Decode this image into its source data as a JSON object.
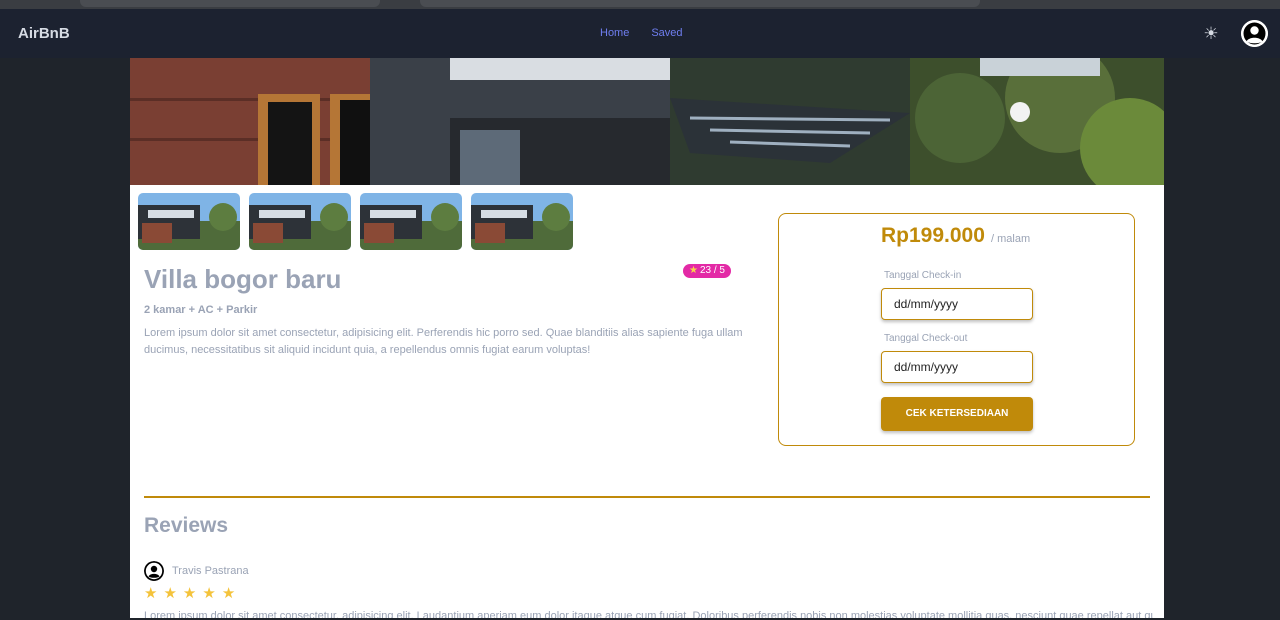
{
  "navbar": {
    "brand": "AirBnB",
    "links": [
      "Home",
      "Saved"
    ],
    "theme_icon": "sun-icon",
    "avatar_icon": "user-avatar-icon"
  },
  "listing": {
    "title": "Villa bogor baru",
    "rating": "23 / 5",
    "amenities": "2 kamar + AC + Parkir",
    "description": "Lorem ipsum dolor sit amet consectetur, adipisicing elit. Perferendis hic porro sed. Quae blanditiis alias sapiente fuga ullam ducimus, necessitatibus sit aliquid incidunt quia, a repellendus omnis fugiat earum voluptas!"
  },
  "booking": {
    "price": "Rp199.000",
    "price_unit": "/ malam",
    "checkin_label": "Tanggal Check-in",
    "checkin_value": "dd/mm/yyyy",
    "checkout_label": "Tanggal Check-out",
    "checkout_value": "dd/mm/yyyy",
    "button_label": "CEK KETERSEDIAAN"
  },
  "reviews": {
    "title": "Reviews",
    "items": [
      {
        "name": "Travis Pastrana",
        "stars": 5,
        "text": "Lorem ipsum dolor sit amet consectetur, adipisicing elit. Laudantium aperiam eum dolor itaque atque cum fugiat. Doloribus perferendis nobis non molestias voluptate mollitia quas, nesciunt quae repellat aut quos."
      }
    ]
  },
  "colors": {
    "accent": "#c08a0a",
    "badge": "#e32aa6",
    "nav_link": "#6f7ef0",
    "star": "#f4c33b"
  }
}
